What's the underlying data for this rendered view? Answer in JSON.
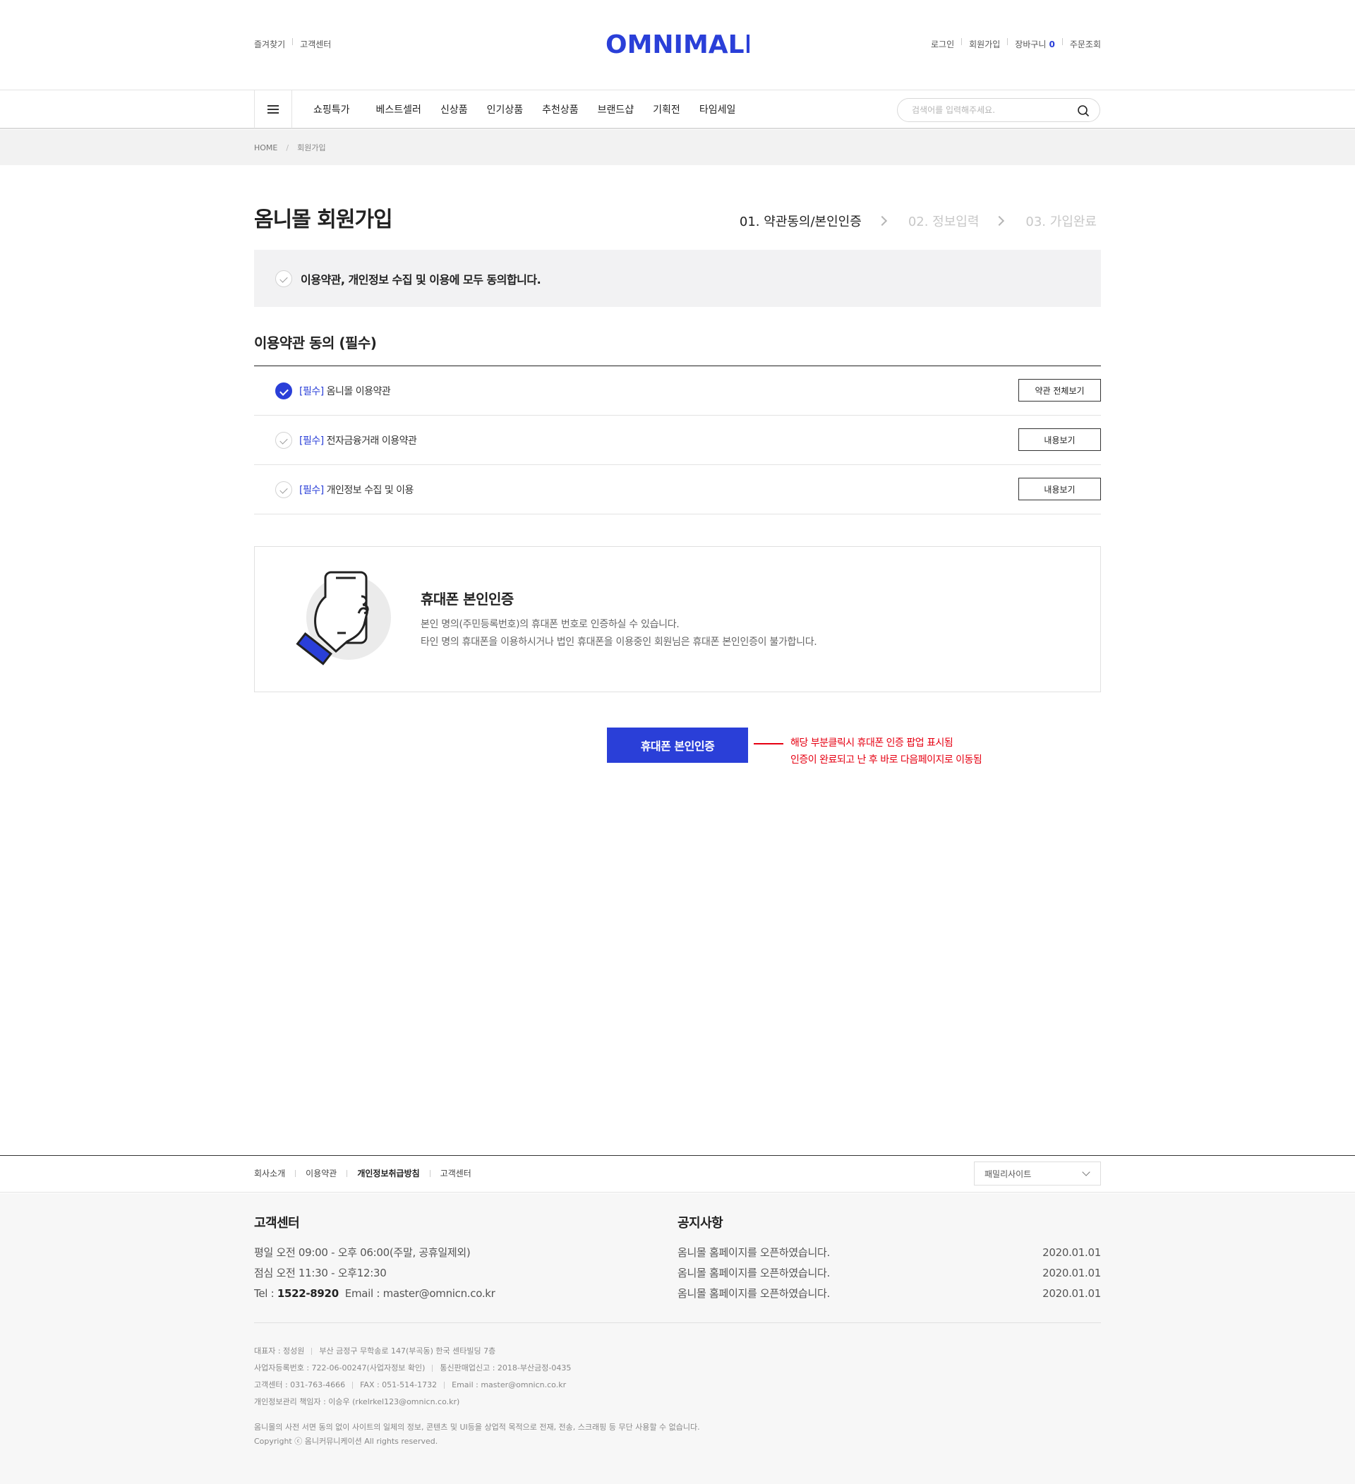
{
  "header": {
    "util_left": [
      "즐겨찾기",
      "고객센터"
    ],
    "util_right": [
      "로그인",
      "회원가입",
      "장바구니",
      "주문조회"
    ],
    "cart_count": "0",
    "logo_text": "OMNIMALL"
  },
  "nav": {
    "items": [
      "쇼핑특가",
      "베스트셀러",
      "신상품",
      "인기상품",
      "추천상품",
      "브랜드샵",
      "기획전",
      "타임세일"
    ],
    "search_placeholder": "검색어를 입력해주세요."
  },
  "breadcrumb": [
    "HOME",
    "회원가입"
  ],
  "page": {
    "title": "옴니몰 회원가입",
    "steps": [
      "01. 약관동의/본인인증",
      "02. 정보입력",
      "03. 가입완료"
    ]
  },
  "agree_all": {
    "label": "이용약관, 개인정보 수집 및 이용에 모두 동의합니다.",
    "checked": false
  },
  "terms": {
    "title": "이용약관 동의 (필수)",
    "items": [
      {
        "tag": "[필수]",
        "label": "옴니몰 이용약관",
        "button": "약관 전체보기",
        "checked": true
      },
      {
        "tag": "[필수]",
        "label": "전자금융거래 이용약관",
        "button": "내용보기",
        "checked": false
      },
      {
        "tag": "[필수]",
        "label": "개인정보 수집 및 이용",
        "button": "내용보기",
        "checked": false
      }
    ]
  },
  "verify": {
    "title": "휴대폰 본인인증",
    "desc1": "본인 명의(주민등록번호)의 휴대폰 번호로 인증하실 수 있습니다.",
    "desc2": "타인 명의 휴대폰을 이용하시거나 법인 휴대폰을 이용중인 회원님은 휴대폰 본인인증이 불가합니다.",
    "button": "휴대폰 본인인증",
    "annotation1": "해당 부분클릭시 휴대폰 인증 팝업 표시됨",
    "annotation2": "인증이 완료되고 난 후 바로 다음페이지로 이동됨"
  },
  "footer": {
    "links": [
      "회사소개",
      "이용약관",
      "개인정보취급방침",
      "고객센터"
    ],
    "family_site": "패밀리사이트",
    "cs_title": "고객센터",
    "cs_hours": "평일 오전 09:00 - 오후 06:00(주말, 공휴일제외)",
    "cs_lunch": "점심 오전 11:30 - 오후12:30",
    "cs_tel_label": "Tel : ",
    "cs_tel": "1522-8920",
    "cs_email": "Email : master@omnicn.co.kr",
    "notice_title": "공지사항",
    "notices": [
      {
        "text": "옴니몰 홈페이지를 오픈하였습니다.",
        "date": "2020.01.01"
      },
      {
        "text": "옴니몰 홈페이지를 오픈하였습니다.",
        "date": "2020.01.01"
      },
      {
        "text": "옴니몰 홈페이지를 오픈하였습니다.",
        "date": "2020.01.01"
      }
    ],
    "ceo": "대표자 : 정성원",
    "address": "부산 금정구 무학송로 147(부곡동) 한국 센타빌딩 7층",
    "biz_no": "사업자등록번호 : 722-06-00247(사업자정보 확인)",
    "mail_order": "통신판매업신고 : 2018-부산금정-0435",
    "cs_phone": "고객센터 : 031-763-4666",
    "fax": "FAX : 051-514-1732",
    "email": "Email : master@omnicn.co.kr",
    "privacy_officer": "개인정보관리 책임자 : 이승우 (rkelrkel123@omnicn.co.kr)",
    "notice_text": "옴니몰의 사전 서면 동의 없이 사이트의 일체의 정보, 콘텐츠 및 UI등을 상업적 목적으로 전재, 전송, 스크래핑 등 무단 사용할 수 없습니다.",
    "copyright": "Copyright ⓒ 옴니커뮤니케이션 All rights reserved."
  },
  "colors": {
    "brand": "#2a3fd8",
    "annotation": "#e60012"
  }
}
